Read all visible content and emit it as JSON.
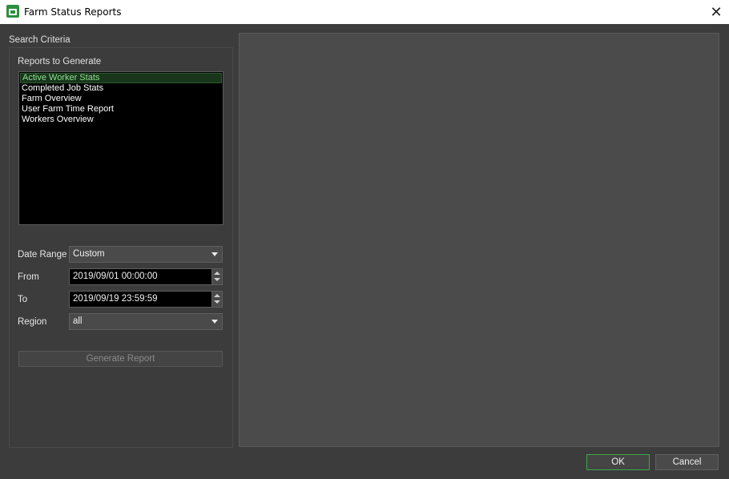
{
  "window": {
    "title": "Farm Status Reports",
    "close_glyph": "✕"
  },
  "search_criteria": {
    "group_label": "Search Criteria",
    "reports_label": "Reports to Generate",
    "reports": [
      "Active Worker Stats",
      "Completed Job Stats",
      "Farm Overview",
      "User Farm Time Report",
      "Workers Overview"
    ],
    "selected_report": "Active Worker Stats",
    "date_range": {
      "label": "Date Range",
      "value": "Custom"
    },
    "from": {
      "label": "From",
      "value": "2019/09/01 00:00:00"
    },
    "to": {
      "label": "To",
      "value": "2019/09/19 23:59:59"
    },
    "region": {
      "label": "Region",
      "value": "all"
    },
    "generate_label": "Generate Report"
  },
  "footer": {
    "ok_label": "OK",
    "cancel_label": "Cancel"
  },
  "colors": {
    "accent": "#3fa84a",
    "selection_text": "#8fe08f",
    "background": "#3c3c3c"
  },
  "icons": {
    "app": "farm-monitor-icon",
    "close": "close-icon"
  }
}
